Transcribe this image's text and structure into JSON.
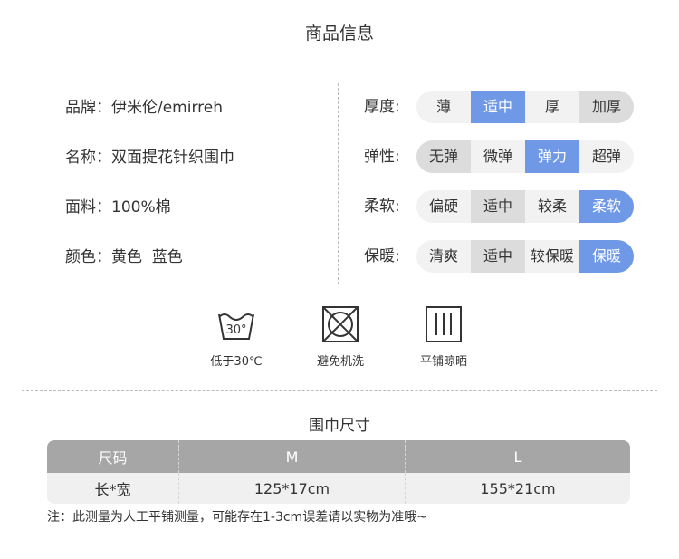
{
  "title": "商品信息",
  "info": [
    {
      "label": "品牌：",
      "value": "伊米伦/emirreh"
    },
    {
      "label": "名称：",
      "value": "双面提花针织围巾"
    },
    {
      "label": "面料：",
      "value": "100%棉"
    },
    {
      "label": "颜色：",
      "value": "黄色  蓝色"
    }
  ],
  "attributes": [
    {
      "label": "厚度:",
      "options": [
        "薄",
        "适中",
        "厚",
        "加厚"
      ],
      "selected": "适中",
      "shaded": [
        "加厚"
      ]
    },
    {
      "label": "弹性:",
      "options": [
        "无弹",
        "微弹",
        "弹力",
        "超弹"
      ],
      "selected": "弹力",
      "shaded": [
        "无弹"
      ]
    },
    {
      "label": "柔软:",
      "options": [
        "偏硬",
        "适中",
        "较柔",
        "柔软"
      ],
      "selected": "柔软",
      "shaded": [
        "适中"
      ]
    },
    {
      "label": "保暖:",
      "options": [
        "清爽",
        "适中",
        "较保暖",
        "保暖"
      ],
      "selected": "保暖",
      "shaded": [
        "适中"
      ]
    }
  ],
  "care": [
    {
      "icon": "wash-30-icon",
      "label": "低于30℃",
      "icon_text": "30°"
    },
    {
      "icon": "no-machine-wash-icon",
      "label": "避免机洗"
    },
    {
      "icon": "dry-flat-icon",
      "label": "平铺晾晒"
    }
  ],
  "size_section": {
    "title": "围巾尺寸",
    "headers": [
      "尺码",
      "M",
      "L"
    ],
    "row": [
      "长*宽",
      "125*17cm",
      "155*21cm"
    ],
    "note": "注：此测量为人工平铺测量，可能存在1-3cm误差请以实物为准哦~"
  },
  "colors": {
    "accent": "#6f99e6",
    "table_header": "#a6a6a6"
  }
}
